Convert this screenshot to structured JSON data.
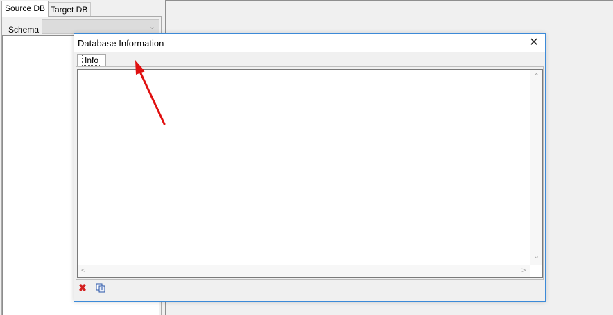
{
  "left_panel": {
    "tabs": [
      {
        "label": "Source DB"
      },
      {
        "label": "Target DB"
      }
    ],
    "schema_label": "Schema",
    "schema_value": ""
  },
  "dialog": {
    "title": "Database Information",
    "close_label": "✕",
    "tabs": [
      {
        "label": "Info"
      }
    ],
    "content": ""
  },
  "icons": {
    "delete": "delete-icon",
    "copy": "copy-icon"
  },
  "colors": {
    "dialog_border": "#3c8ad8",
    "arrow": "#e01010"
  }
}
